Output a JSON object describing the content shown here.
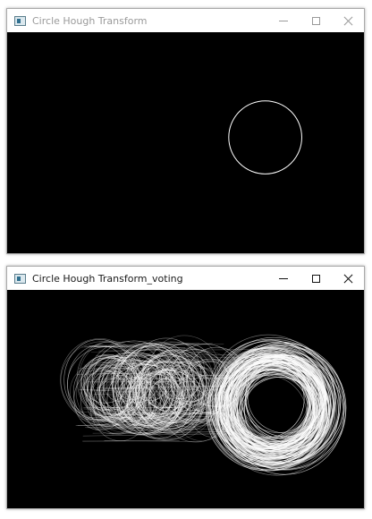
{
  "window_top": {
    "title": "Circle Hough Transform",
    "controls": {
      "minimize": "minimize",
      "maximize": "maximize",
      "close": "close"
    },
    "canvas_bg": "#000000",
    "stroke_color": "#ffffff"
  },
  "window_bottom": {
    "title": "Circle Hough Transform_voting",
    "controls": {
      "minimize": "minimize",
      "maximize": "maximize",
      "close": "close"
    },
    "canvas_bg": "#000000",
    "stroke_color": "#ffffff"
  }
}
